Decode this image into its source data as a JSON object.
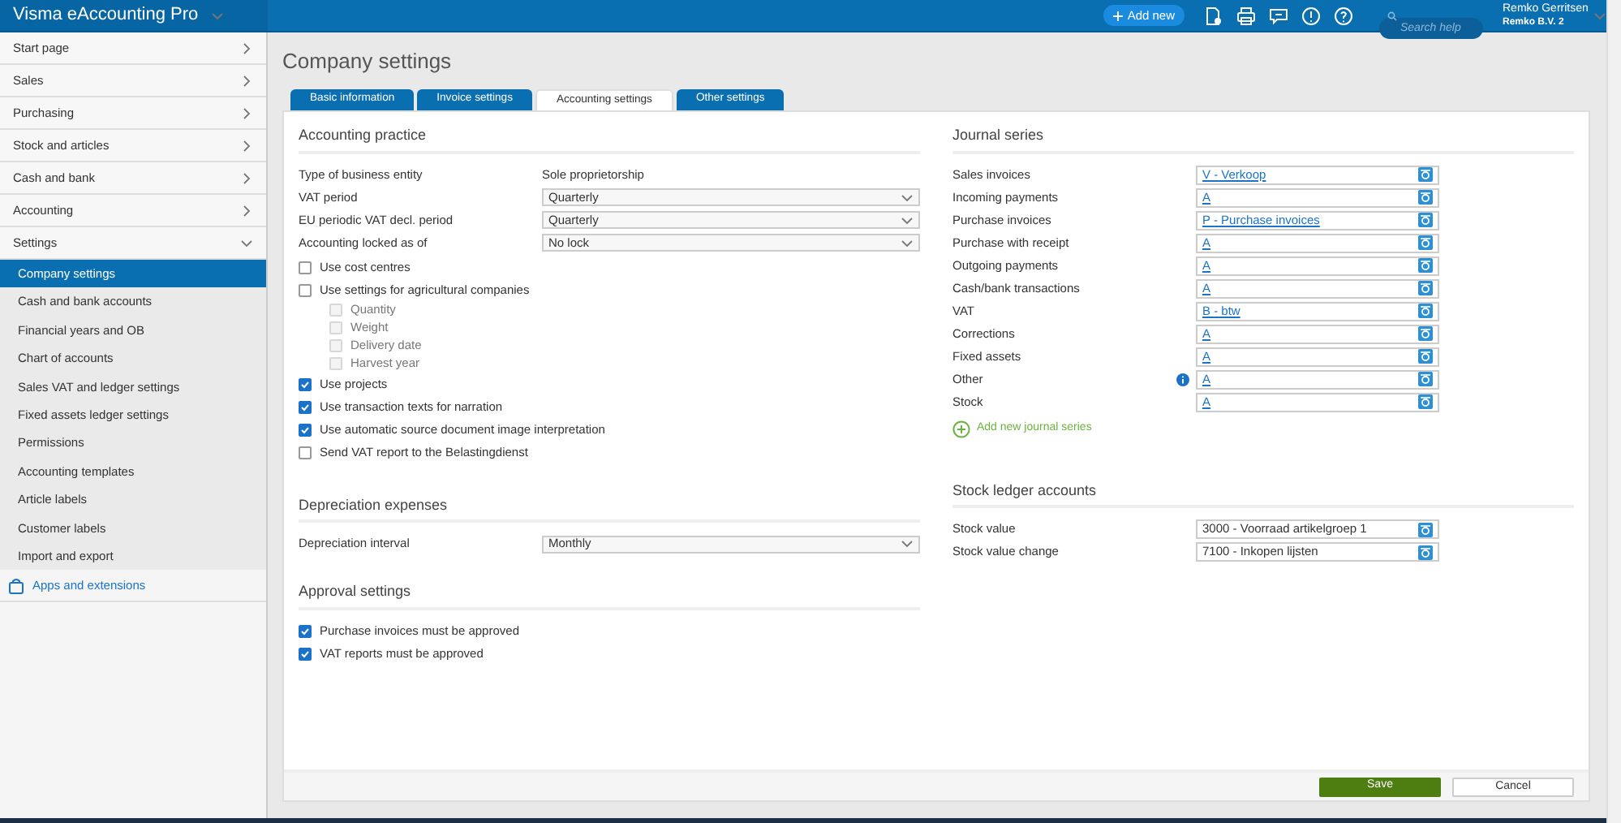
{
  "app": {
    "title": "Visma eAccounting Pro"
  },
  "topbar": {
    "add_new": "Add new",
    "search": {
      "placeholder": "Search help"
    },
    "user": "Remko Gerritsen",
    "company": "Remko B.V. 2"
  },
  "sidebar": {
    "items": [
      {
        "label": "Start page",
        "expanded": false
      },
      {
        "label": "Sales",
        "expanded": false
      },
      {
        "label": "Purchasing",
        "expanded": false
      },
      {
        "label": "Stock and articles",
        "expanded": false
      },
      {
        "label": "Cash and bank",
        "expanded": false
      },
      {
        "label": "Accounting",
        "expanded": false
      },
      {
        "label": "Settings",
        "expanded": true,
        "children": [
          {
            "label": "Company settings",
            "selected": true
          },
          {
            "label": "Cash and bank accounts",
            "selected": false
          },
          {
            "label": "Financial years and OB",
            "selected": false
          },
          {
            "label": "Chart of accounts",
            "selected": false
          },
          {
            "label": "Sales VAT and ledger settings",
            "selected": false
          },
          {
            "label": "Fixed assets ledger settings",
            "selected": false
          },
          {
            "label": "Permissions",
            "selected": false
          },
          {
            "label": "Accounting templates",
            "selected": false
          },
          {
            "label": "Article labels",
            "selected": false
          },
          {
            "label": "Customer labels",
            "selected": false
          },
          {
            "label": "Import and export",
            "selected": false
          }
        ]
      }
    ],
    "apps_link": "Apps and extensions"
  },
  "page": {
    "title": "Company settings"
  },
  "tabs": [
    {
      "label": "Basic information",
      "selected": false
    },
    {
      "label": "Invoice settings",
      "selected": false
    },
    {
      "label": "Accounting settings",
      "selected": true
    },
    {
      "label": "Other settings",
      "selected": false
    }
  ],
  "accounting_practice": {
    "title": "Accounting practice",
    "fields": [
      {
        "kind": "text",
        "label": "Type of business entity",
        "value": "Sole proprietorship"
      },
      {
        "kind": "select",
        "label": "VAT period",
        "value": "Quarterly"
      },
      {
        "kind": "select",
        "label": "EU periodic VAT decl. period",
        "value": "Quarterly"
      },
      {
        "kind": "select",
        "label": "Accounting locked as of",
        "value": "No lock"
      }
    ],
    "checkboxes": [
      {
        "label": "Use cost centres",
        "checked": false
      },
      {
        "label": "Use settings for agricultural companies",
        "checked": false,
        "children": [
          {
            "label": "Quantity",
            "checked": false,
            "disabled": true
          },
          {
            "label": "Weight",
            "checked": false,
            "disabled": true
          },
          {
            "label": "Delivery date",
            "checked": false,
            "disabled": true
          },
          {
            "label": "Harvest year",
            "checked": false,
            "disabled": true
          }
        ]
      },
      {
        "label": "Use projects",
        "checked": true
      },
      {
        "label": "Use transaction texts for narration",
        "checked": true
      },
      {
        "label": "Use automatic source document image interpretation",
        "checked": true
      },
      {
        "label": "Send VAT report to the Belastingdienst",
        "checked": false
      }
    ]
  },
  "depreciation": {
    "title": "Depreciation expenses",
    "fields": [
      {
        "kind": "select",
        "label": "Depreciation interval",
        "value": "Monthly"
      }
    ]
  },
  "approval": {
    "title": "Approval settings",
    "checkboxes": [
      {
        "label": "Purchase invoices must be approved",
        "checked": true
      },
      {
        "label": "VAT reports must be approved",
        "checked": true
      }
    ]
  },
  "journal_series": {
    "title": "Journal series",
    "rows": [
      {
        "label": "Sales invoices",
        "value": "V - Verkoop"
      },
      {
        "label": "Incoming payments",
        "value": "A"
      },
      {
        "label": "Purchase invoices",
        "value": "P - Purchase invoices"
      },
      {
        "label": "Purchase with receipt",
        "value": "A"
      },
      {
        "label": "Outgoing payments",
        "value": "A"
      },
      {
        "label": "Cash/bank transactions",
        "value": "A"
      },
      {
        "label": "VAT",
        "value": "B - btw"
      },
      {
        "label": "Corrections",
        "value": "A"
      },
      {
        "label": "Fixed assets",
        "value": "A"
      },
      {
        "label": "Other",
        "value": "A",
        "info": true
      },
      {
        "label": "Stock",
        "value": "A"
      }
    ],
    "add_link": "Add new journal series"
  },
  "stock_ledger": {
    "title": "Stock ledger accounts",
    "rows": [
      {
        "label": "Stock value",
        "value": "3000 - Voorraad artikelgroep 1"
      },
      {
        "label": "Stock value change",
        "value": "7100 - Inkopen lijsten"
      }
    ]
  },
  "buttons": {
    "save": "Save",
    "cancel": "Cancel"
  }
}
